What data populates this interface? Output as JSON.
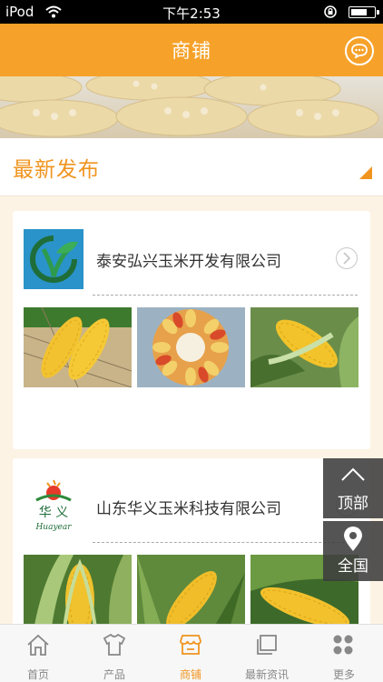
{
  "status_bar": {
    "carrier": "iPod",
    "time": "下午2:53",
    "battery_level": 0.75
  },
  "navbar": {
    "title": "商铺",
    "chat_icon": "chat-bubble-icon"
  },
  "section": {
    "title": "最新发布"
  },
  "shops": [
    {
      "name": "泰安弘兴玉米开发有限公司",
      "logo_icon": "leaf-logo-icon",
      "photos": [
        "corn-cob-pair-photo",
        "corn-cross-section-photo",
        "corn-on-stalk-photo"
      ]
    },
    {
      "name": "山东华义玉米科技有限公司",
      "logo_icon": "huayi-logo-icon",
      "photos": [
        "corn-husk-photo",
        "corn-field-photo",
        "corn-ear-photo"
      ]
    }
  ],
  "floating": {
    "top_label": "顶部",
    "region_label": "全国"
  },
  "tabbar": {
    "items": [
      {
        "label": "首页",
        "icon": "home-icon",
        "active": false
      },
      {
        "label": "产品",
        "icon": "shirt-icon",
        "active": false
      },
      {
        "label": "商铺",
        "icon": "shop-icon",
        "active": true
      },
      {
        "label": "最新资讯",
        "icon": "news-icon",
        "active": false
      },
      {
        "label": "更多",
        "icon": "more-grid-icon",
        "active": false
      }
    ]
  },
  "colors": {
    "accent": "#f6a22a",
    "section_title": "#f0941f",
    "background": "#fdf3e4"
  }
}
